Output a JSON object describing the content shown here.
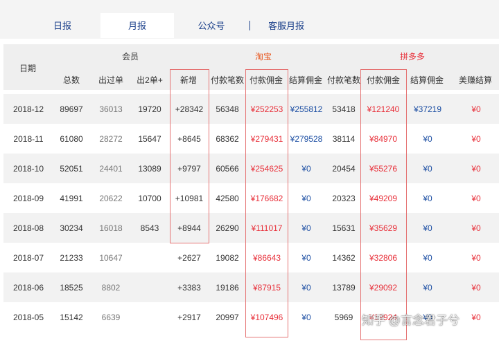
{
  "tabs": [
    "日报",
    "月报",
    "公众号",
    "客服月报"
  ],
  "header": {
    "date": "日期",
    "member": "会员",
    "taobao": "淘宝",
    "pdd": "拼多多",
    "member_cols": [
      "总数",
      "出过单",
      "出2单+",
      "新增"
    ],
    "taobao_cols": [
      "付款笔数",
      "付款佣金",
      "结算佣金"
    ],
    "pdd_cols": [
      "付款笔数",
      "付款佣金",
      "结算佣金",
      "美赚结算"
    ]
  },
  "rows": [
    {
      "date": "2018-12",
      "total": "89697",
      "ordered": "36013",
      "ordered2": "19720",
      "new": "+28342",
      "tb_count": "56348",
      "tb_pay": "¥252253",
      "tb_settle": "¥255812",
      "pdd_count": "53418",
      "pdd_pay": "¥121240",
      "pdd_settle": "¥37219",
      "mz": "¥0"
    },
    {
      "date": "2018-11",
      "total": "61080",
      "ordered": "28272",
      "ordered2": "15647",
      "new": "+8645",
      "tb_count": "68362",
      "tb_pay": "¥279431",
      "tb_settle": "¥279528",
      "pdd_count": "38114",
      "pdd_pay": "¥84970",
      "pdd_settle": "¥0",
      "mz": "¥0"
    },
    {
      "date": "2018-10",
      "total": "52051",
      "ordered": "24401",
      "ordered2": "13089",
      "new": "+9797",
      "tb_count": "60566",
      "tb_pay": "¥254625",
      "tb_settle": "¥0",
      "pdd_count": "20454",
      "pdd_pay": "¥55276",
      "pdd_settle": "¥0",
      "mz": "¥0"
    },
    {
      "date": "2018-09",
      "total": "41991",
      "ordered": "20622",
      "ordered2": "10700",
      "new": "+10981",
      "tb_count": "42580",
      "tb_pay": "¥176682",
      "tb_settle": "¥0",
      "pdd_count": "20323",
      "pdd_pay": "¥49209",
      "pdd_settle": "¥0",
      "mz": "¥0"
    },
    {
      "date": "2018-08",
      "total": "30234",
      "ordered": "16018",
      "ordered2": "8543",
      "new": "+8944",
      "tb_count": "26290",
      "tb_pay": "¥111017",
      "tb_settle": "¥0",
      "pdd_count": "15631",
      "pdd_pay": "¥35629",
      "pdd_settle": "¥0",
      "mz": "¥0"
    },
    {
      "date": "2018-07",
      "total": "21233",
      "ordered": "10647",
      "ordered2": "",
      "new": "+2627",
      "tb_count": "19082",
      "tb_pay": "¥86643",
      "tb_settle": "¥0",
      "pdd_count": "14362",
      "pdd_pay": "¥32806",
      "pdd_settle": "¥0",
      "mz": "¥0"
    },
    {
      "date": "2018-06",
      "total": "18525",
      "ordered": "8802",
      "ordered2": "",
      "new": "+3383",
      "tb_count": "19186",
      "tb_pay": "¥87915",
      "tb_settle": "¥0",
      "pdd_count": "13789",
      "pdd_pay": "¥29092",
      "pdd_settle": "¥0",
      "mz": "¥0"
    },
    {
      "date": "2018-05",
      "total": "15142",
      "ordered": "6639",
      "ordered2": "",
      "new": "+2917",
      "tb_count": "20997",
      "tb_pay": "¥107496",
      "tb_settle": "¥0",
      "pdd_count": "5969",
      "pdd_pay": "¥19924",
      "pdd_settle": "¥0",
      "mz": "¥0"
    }
  ],
  "watermark": "知乎 @言念君子兮",
  "colors": {
    "link_blue": "#1a3f8a",
    "taobao_orange": "#e8561e",
    "red": "#e8303a",
    "blue_value": "#1d4fa3",
    "highlight_box": "#e57373"
  }
}
